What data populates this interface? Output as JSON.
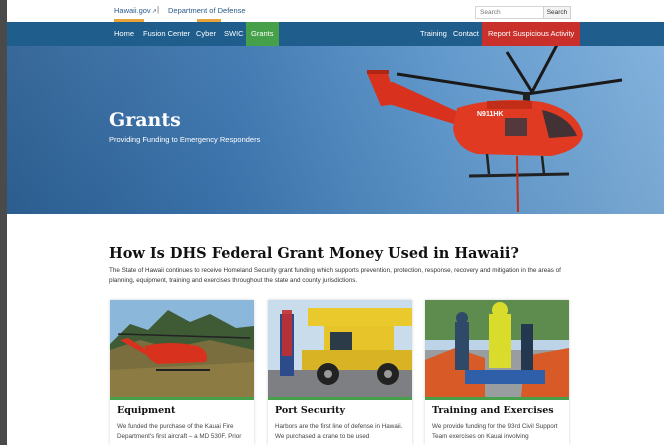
{
  "topbar": {
    "hawaii_link": "Hawaii.gov",
    "separator": "|",
    "dept_link": "Department of Defense",
    "search_placeholder": "Search",
    "search_button": "Search"
  },
  "nav": {
    "left": [
      "Home",
      "Fusion Center",
      "Cyber",
      "SWIC",
      "Grants"
    ],
    "active": "Grants",
    "right": [
      "Training",
      "Contact"
    ],
    "report": "Report Suspicious Activity"
  },
  "hero": {
    "title": "Grants",
    "subtitle": "Providing Funding to Emergency Responders",
    "tail_number": "N911HK"
  },
  "section": {
    "heading": "How Is DHS Federal Grant Money Used in Hawaii?",
    "intro": "The State of Hawaii continues to receive Homeland Security grant funding which supports prevention, protection, response, recovery and mitigation in the areas of planning, equipment, training and exercises throughout the state and county jurisdictions."
  },
  "cards": [
    {
      "title": "Equipment",
      "text": "We funded the purchase of the Kauai Fire Department's first aircraft – a MD 530F. Prior"
    },
    {
      "title": "Port Security",
      "text": "Harbors are the first line of defense in Hawaii. We purchased a crane to be used"
    },
    {
      "title": "Training and Exercises",
      "text": "We provide funding for the 93rd Civil Support Team exercises on Kauai involving"
    }
  ],
  "colors": {
    "nav_bg": "#1f5d8c",
    "active_tab": "#46a04a",
    "report_button": "#c9302c",
    "accent": "#e8a33a"
  }
}
